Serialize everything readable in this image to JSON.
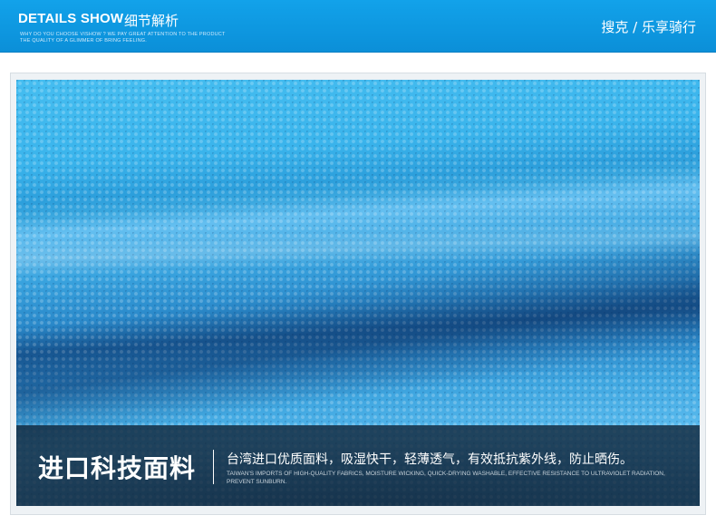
{
  "header": {
    "title_en": "DETAILS SHOW",
    "title_cn": "细节解析",
    "subtitle_line1": "WHY DO YOU CHOOSE VISHOW ? WE PAY GREAT ATTENTION TO THE PRODUCT",
    "subtitle_line2": "THE QUALITY OF A GLIMMER OF BRING FEELING.",
    "brand": "搜克 / 乐享骑行",
    "accent_color": "#0b8fd8"
  },
  "photo": {
    "subject": "fabric-closeup",
    "fabric_color": "#3aa5e0"
  },
  "caption": {
    "title": "进口科技面料",
    "description": "台湾进口优质面料，吸湿快干，轻薄透气，有效抵抗紫外线，防止晒伤。",
    "description_en": "TAIWAN'S IMPORTS OF HIGH-QUALITY FABRICS, MOISTURE WICKING, QUICK-DRYING WASHABLE, EFFECTIVE RESISTANCE TO ULTRAVIOLET RADIATION, PREVENT SUNBURN."
  }
}
